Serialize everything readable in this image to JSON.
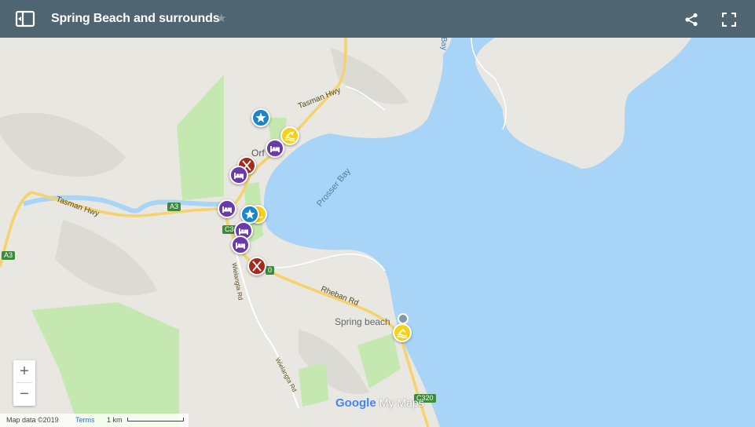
{
  "header": {
    "title": "Spring Beach and surrounds",
    "star_glyph": "★"
  },
  "map": {
    "place_labels": {
      "orford": "Orf",
      "prosser_bay": "Prosser Bay",
      "spring_beach": "Spring beach",
      "bay_top": "Bay"
    },
    "road_labels": {
      "tasman_hwy_north": "Tasman Hwy",
      "tasman_hwy_west": "Tasman Hwy",
      "rheban_rd": "Rheban Rd",
      "wielangta_rd_1": "Wielangta Rd",
      "wielangta_rd_2": "Wielangta Rd"
    },
    "shields": {
      "a3_mid": "A3",
      "a3_left": "A3",
      "c3_1": "C3",
      "c3_2": "0",
      "c320": "C320"
    },
    "markers": [
      {
        "type": "attraction",
        "icon": "star-icon",
        "color": "#1a86c8"
      },
      {
        "type": "swimming",
        "icon": "swim-icon",
        "color": "#f7d117"
      },
      {
        "type": "accommodation",
        "icon": "bed-icon",
        "color": "#6a3aa8"
      },
      {
        "type": "restaurant",
        "icon": "cutlery-icon",
        "color": "#a52a1e"
      },
      {
        "type": "accommodation",
        "icon": "bed-icon",
        "color": "#6a3aa8"
      },
      {
        "type": "accommodation",
        "icon": "bed-icon",
        "color": "#6a3aa8"
      },
      {
        "type": "restaurant",
        "icon": "cutlery-icon",
        "color": "#a52a1e"
      },
      {
        "type": "swimming",
        "icon": "swim-icon",
        "color": "#f7d117"
      },
      {
        "type": "attraction",
        "icon": "star-icon",
        "color": "#1a86c8"
      },
      {
        "type": "accommodation",
        "icon": "bed-icon",
        "color": "#6a3aa8"
      },
      {
        "type": "accommodation",
        "icon": "bed-icon",
        "color": "#6a3aa8"
      },
      {
        "type": "restaurant",
        "icon": "cutlery-icon",
        "color": "#a52a1e"
      },
      {
        "type": "swimming",
        "icon": "swim-icon",
        "color": "#f7d117"
      }
    ],
    "colors": {
      "water": "#a8d5f7",
      "land": "#e9e7e2",
      "park": "#c5e8b0",
      "road": "#f5d26b"
    }
  },
  "controls": {
    "zoom_in": "+",
    "zoom_out": "−"
  },
  "footer": {
    "map_data": "Map data ©2019",
    "terms": "Terms",
    "scale": "1 km"
  },
  "logo": {
    "google": "Google",
    "mymaps": "My Maps"
  }
}
